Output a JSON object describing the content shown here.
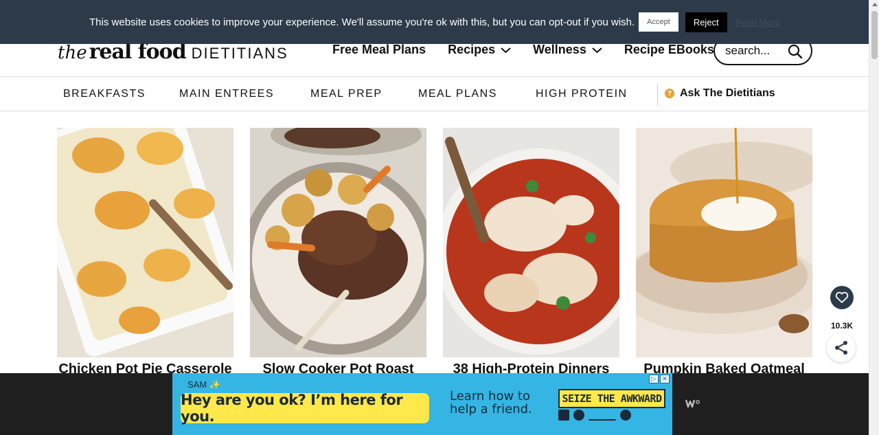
{
  "cookie": {
    "message": "This website uses cookies to improve your experience. We'll assume you're ok with this, but you can opt-out if you wish.",
    "accept_label": "Accept",
    "reject_label": "Reject",
    "read_more_label": "Read More"
  },
  "header": {
    "logo_the": "the",
    "logo_realfood": "real food",
    "logo_dietitians": "DIETITIANS",
    "nav": [
      {
        "label": "Free Meal Plans",
        "dropdown": false
      },
      {
        "label": "Recipes",
        "dropdown": true
      },
      {
        "label": "Wellness",
        "dropdown": true
      },
      {
        "label": "Recipe EBooks",
        "dropdown": false
      }
    ],
    "search_placeholder": "search..."
  },
  "subnav": {
    "items": [
      "BREAKFASTS",
      "MAIN ENTREES",
      "MEAL PREP",
      "MEAL PLANS",
      "HIGH PROTEIN"
    ],
    "ask_label": "Ask The Dietitians",
    "ask_icon": "question-icon"
  },
  "cards": [
    {
      "title": "Chicken Pot Pie Casserole"
    },
    {
      "title": "Slow Cooker Pot Roast"
    },
    {
      "title": "38 High-Protein Dinners"
    },
    {
      "title": "Pumpkin Baked Oatmeal"
    }
  ],
  "share": {
    "count": "10.3K",
    "heart_icon": "heart-icon",
    "share_icon": "share-icon"
  },
  "ad": {
    "sender": "SAM ✨",
    "bubble": "Hey are you ok? I’m here for you.",
    "learn": "Learn how to help a friend.",
    "seize": "SEIZE THE AWKWARD",
    "ad_choice_icon": "adchoices-icon",
    "brand_icon": "ad-brand-icon"
  },
  "colors": {
    "cookie_bg": "#2c3a4a",
    "ad_bg": "#35b5e3",
    "ad_yellow": "#ffe84a",
    "ask_icon": "#e0a43a"
  }
}
